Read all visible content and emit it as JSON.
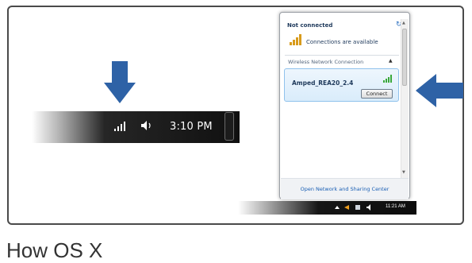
{
  "taskbar": {
    "clock": "3:10 PM",
    "signal_icon": "signal-bars-icon",
    "speaker_icon": "speaker-icon"
  },
  "flyout": {
    "status_title": "Not connected",
    "availability": "Connections are available",
    "section_label": "Wireless Network Connection",
    "network": {
      "ssid": "Amped_REA20_2.4",
      "connect_label": "Connect"
    },
    "footer_link": "Open Network and Sharing Center"
  },
  "tray": {
    "time": "11:21 AM"
  },
  "caption": "How OS X",
  "colors": {
    "arrow": "#2e62a6",
    "frame": "#4a4a4a",
    "signal_green": "#3aa83a"
  }
}
